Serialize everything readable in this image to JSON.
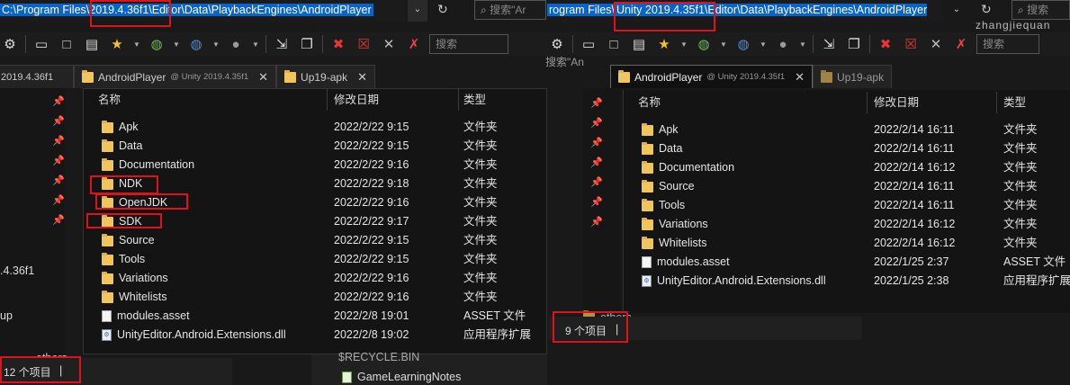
{
  "left": {
    "address_path": "C:\\Program Files\\2019.4.36f1\\Editor\\Data\\PlaybackEngines\\AndroidPlayer",
    "search_placeholder": "搜索\"Ar",
    "toolbar_search_placeholder": "搜索",
    "tabs": [
      {
        "label": "2019.4.36f1"
      },
      {
        "label": "AndroidPlayer",
        "sub": "@ Unity 2019.4.35f1",
        "close": "✕"
      },
      {
        "label": "Up19-apk",
        "close": "✕"
      }
    ],
    "columns": {
      "name": "名称",
      "date": "修改日期",
      "type": "类型"
    },
    "rows": [
      {
        "name": "Apk",
        "date": "2022/2/22 9:15",
        "type": "文件夹",
        "kind": "folder"
      },
      {
        "name": "Data",
        "date": "2022/2/22 9:15",
        "type": "文件夹",
        "kind": "folder"
      },
      {
        "name": "Documentation",
        "date": "2022/2/22 9:16",
        "type": "文件夹",
        "kind": "folder"
      },
      {
        "name": "NDK",
        "date": "2022/2/22 9:18",
        "type": "文件夹",
        "kind": "folder"
      },
      {
        "name": "OpenJDK",
        "date": "2022/2/22 9:16",
        "type": "文件夹",
        "kind": "folder"
      },
      {
        "name": "SDK",
        "date": "2022/2/22 9:17",
        "type": "文件夹",
        "kind": "folder"
      },
      {
        "name": "Source",
        "date": "2022/2/22 9:15",
        "type": "文件夹",
        "kind": "folder"
      },
      {
        "name": "Tools",
        "date": "2022/2/22 9:15",
        "type": "文件夹",
        "kind": "folder"
      },
      {
        "name": "Variations",
        "date": "2022/2/22 9:16",
        "type": "文件夹",
        "kind": "folder"
      },
      {
        "name": "Whitelists",
        "date": "2022/2/22 9:16",
        "type": "文件夹",
        "kind": "folder"
      },
      {
        "name": "modules.asset",
        "date": "2022/2/8 19:01",
        "type": "ASSET 文件",
        "kind": "file"
      },
      {
        "name": "UnityEditor.Android.Extensions.dll",
        "date": "2022/2/8 19:02",
        "type": "应用程序扩展",
        "kind": "dll"
      }
    ],
    "side_labels": {
      "version": ".4.36f1",
      "up": "up",
      "others": "others"
    },
    "status": "12 个项目",
    "below_items": [
      "$RECYCLE.BIN",
      "GameLearningNotes"
    ]
  },
  "right": {
    "address_path_prefix": "rogram Files\\",
    "address_path_main": "Unity 2019.4.35f1\\Editor\\Data\\PlaybackEngines\\AndroidPlayer",
    "search_placeholder": "搜索",
    "toolbar_search_placeholder": "搜索",
    "tabs": [
      {
        "label": "AndroidPlayer",
        "sub": "@ Unity 2019.4.35f1",
        "close": "✕"
      },
      {
        "label": "Up19-apk"
      }
    ],
    "columns": {
      "name": "名称",
      "date": "修改日期",
      "type": "类型"
    },
    "rows": [
      {
        "name": "Apk",
        "date": "2022/2/14 16:11",
        "type": "文件夹",
        "kind": "folder"
      },
      {
        "name": "Data",
        "date": "2022/2/14 16:11",
        "type": "文件夹",
        "kind": "folder"
      },
      {
        "name": "Documentation",
        "date": "2022/2/14 16:12",
        "type": "文件夹",
        "kind": "folder"
      },
      {
        "name": "Source",
        "date": "2022/2/14 16:11",
        "type": "文件夹",
        "kind": "folder"
      },
      {
        "name": "Tools",
        "date": "2022/2/14 16:11",
        "type": "文件夹",
        "kind": "folder"
      },
      {
        "name": "Variations",
        "date": "2022/2/14 16:12",
        "type": "文件夹",
        "kind": "folder"
      },
      {
        "name": "Whitelists",
        "date": "2022/2/14 16:12",
        "type": "文件夹",
        "kind": "folder"
      },
      {
        "name": "modules.asset",
        "date": "2022/1/25 2:37",
        "type": "ASSET 文件",
        "kind": "file"
      },
      {
        "name": "UnityEditor.Android.Extensions.dll",
        "date": "2022/1/25 2:38",
        "type": "应用程序扩展",
        "kind": "dll"
      }
    ],
    "behind_search": "搜索\"An",
    "behind_others": "others",
    "status": "9 个项目"
  },
  "watermark": "zhangjiequan",
  "colors": {
    "annotation": "#e0111b",
    "selection": "#0a64c8",
    "folder": "#f2c55c"
  }
}
